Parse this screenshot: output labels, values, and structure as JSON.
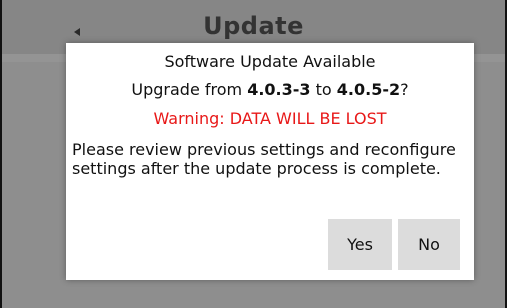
{
  "header": {
    "title": "Update"
  },
  "dialog": {
    "title": "Software Update Available",
    "upgrade_prefix": "Upgrade from ",
    "from_version": "4.0.3-3",
    "upgrade_middle": " to ",
    "to_version": "4.0.5-2",
    "upgrade_suffix": "?",
    "warning": "Warning: DATA WILL BE LOST",
    "message": "Please review previous settings and reconfigure settings after the update process is complete.",
    "yes_label": "Yes",
    "no_label": "No"
  },
  "colors": {
    "warning": "#e81818",
    "button_bg": "#dcdcdc",
    "backdrop": "#8a8a8a"
  }
}
